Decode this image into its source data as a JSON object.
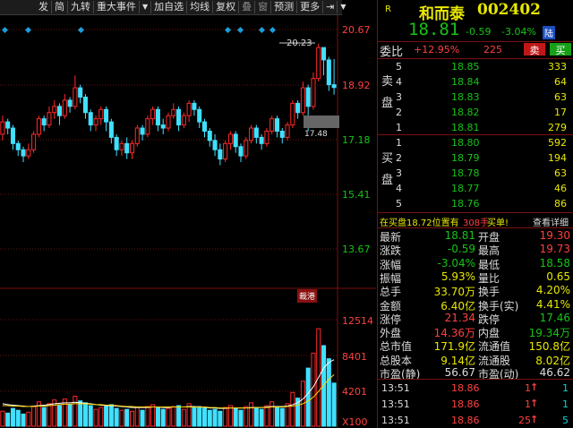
{
  "toolbar": {
    "items": [
      "发",
      "简",
      "九转",
      "重大事件",
      "加自选",
      "均线",
      "复权",
      "叠",
      "窗",
      "预测",
      "更多"
    ],
    "arrow_label": "⇥",
    "dropdown_label": "▼"
  },
  "chart": {
    "price_ticks": [
      "20.67",
      "18.92",
      "17.18",
      "15.41",
      "13.67"
    ],
    "volume_ticks": [
      "12514",
      "8401",
      "4201"
    ],
    "volume_unit": "X100",
    "high_label": "20.23",
    "low_label": "17.48",
    "tag_label": "裁港",
    "price_range": [
      12.7,
      21.0
    ],
    "volume_max": 12514,
    "up_color": "#ff2a2a",
    "down_color": "#40e0ff",
    "candles": [
      [
        17.3,
        17.7,
        17.9,
        17.1
      ],
      [
        17.7,
        17.5,
        17.8,
        17.3
      ],
      [
        17.5,
        17.0,
        17.6,
        16.8
      ],
      [
        17.0,
        16.8,
        17.1,
        16.6
      ],
      [
        16.8,
        16.6,
        16.9,
        16.4
      ],
      [
        16.6,
        16.8,
        17.0,
        16.5
      ],
      [
        16.8,
        17.3,
        17.4,
        16.7
      ],
      [
        17.3,
        17.8,
        17.9,
        17.2
      ],
      [
        17.8,
        17.6,
        17.9,
        17.4
      ],
      [
        17.6,
        18.0,
        18.2,
        17.5
      ],
      [
        18.0,
        18.2,
        18.4,
        17.8
      ],
      [
        18.2,
        17.9,
        18.3,
        17.6
      ],
      [
        17.9,
        18.4,
        18.6,
        17.8
      ],
      [
        18.4,
        18.2,
        18.5,
        18.0
      ],
      [
        18.2,
        18.8,
        19.2,
        18.1
      ],
      [
        18.8,
        18.5,
        18.9,
        18.3
      ],
      [
        18.5,
        18.0,
        18.6,
        17.8
      ],
      [
        18.0,
        17.6,
        18.1,
        17.4
      ],
      [
        17.6,
        17.8,
        17.9,
        17.4
      ],
      [
        17.8,
        18.1,
        18.2,
        17.6
      ],
      [
        18.1,
        17.7,
        18.2,
        17.4
      ],
      [
        17.7,
        17.2,
        17.8,
        17.0
      ],
      [
        17.2,
        16.8,
        17.3,
        16.6
      ],
      [
        16.8,
        17.0,
        17.1,
        16.6
      ],
      [
        17.0,
        16.7,
        17.2,
        16.5
      ],
      [
        16.7,
        17.0,
        17.1,
        16.5
      ],
      [
        17.0,
        17.5,
        17.6,
        16.9
      ],
      [
        17.5,
        17.3,
        17.6,
        17.1
      ],
      [
        17.3,
        17.8,
        17.9,
        17.2
      ],
      [
        17.8,
        18.1,
        18.2,
        17.6
      ],
      [
        18.1,
        17.6,
        18.2,
        17.4
      ],
      [
        17.6,
        17.5,
        17.8,
        17.3
      ],
      [
        17.5,
        17.9,
        18.0,
        17.4
      ],
      [
        17.9,
        18.1,
        18.3,
        17.8
      ],
      [
        18.1,
        17.6,
        18.2,
        17.4
      ],
      [
        17.6,
        17.9,
        18.0,
        17.5
      ],
      [
        17.9,
        18.3,
        18.4,
        17.7
      ],
      [
        18.3,
        18.1,
        18.4,
        17.9
      ],
      [
        18.1,
        17.7,
        18.2,
        17.5
      ],
      [
        17.7,
        17.4,
        17.8,
        17.2
      ],
      [
        17.4,
        17.1,
        17.5,
        16.9
      ],
      [
        17.1,
        16.8,
        17.3,
        16.6
      ],
      [
        16.8,
        16.5,
        17.0,
        16.3
      ],
      [
        16.5,
        17.0,
        17.1,
        16.4
      ],
      [
        17.0,
        17.3,
        17.4,
        16.8
      ],
      [
        17.3,
        16.9,
        17.4,
        16.7
      ],
      [
        16.9,
        16.6,
        17.0,
        16.4
      ],
      [
        16.6,
        17.1,
        17.2,
        16.5
      ],
      [
        17.1,
        17.5,
        17.6,
        17.0
      ],
      [
        17.5,
        17.2,
        17.6,
        17.0
      ],
      [
        17.2,
        17.0,
        17.3,
        16.8
      ],
      [
        17.0,
        17.4,
        17.5,
        16.9
      ],
      [
        17.4,
        17.8,
        17.9,
        17.3
      ],
      [
        17.8,
        17.4,
        17.9,
        17.2
      ],
      [
        17.4,
        17.2,
        17.5,
        17.0
      ],
      [
        17.2,
        17.6,
        17.7,
        17.1
      ],
      [
        17.6,
        18.3,
        18.4,
        17.5
      ],
      [
        18.3,
        18.0,
        18.4,
        17.8
      ],
      [
        18.0,
        18.8,
        19.0,
        17.9
      ],
      [
        18.8,
        18.2,
        18.9,
        17.4
      ],
      [
        18.2,
        19.1,
        19.3,
        18.1
      ],
      [
        19.1,
        20.1,
        20.23,
        19.0
      ],
      [
        20.1,
        19.7,
        20.1,
        19.2
      ],
      [
        19.7,
        18.9,
        19.8,
        18.7
      ],
      [
        18.9,
        18.81,
        19.73,
        18.58
      ]
    ],
    "volumes": [
      [
        1600,
        0
      ],
      [
        1400,
        1
      ],
      [
        1900,
        1
      ],
      [
        1700,
        1
      ],
      [
        1300,
        1
      ],
      [
        1500,
        0
      ],
      [
        2100,
        0
      ],
      [
        2600,
        0
      ],
      [
        2000,
        1
      ],
      [
        2400,
        0
      ],
      [
        2800,
        0
      ],
      [
        2200,
        1
      ],
      [
        2900,
        0
      ],
      [
        2300,
        1
      ],
      [
        3200,
        0
      ],
      [
        2700,
        1
      ],
      [
        2500,
        1
      ],
      [
        2200,
        1
      ],
      [
        1800,
        0
      ],
      [
        2000,
        0
      ],
      [
        2100,
        1
      ],
      [
        2300,
        1
      ],
      [
        1900,
        1
      ],
      [
        1700,
        0
      ],
      [
        1800,
        1
      ],
      [
        1600,
        0
      ],
      [
        2000,
        0
      ],
      [
        1700,
        1
      ],
      [
        2100,
        0
      ],
      [
        2300,
        0
      ],
      [
        2000,
        1
      ],
      [
        1800,
        1
      ],
      [
        1900,
        0
      ],
      [
        2100,
        0
      ],
      [
        2200,
        1
      ],
      [
        1800,
        0
      ],
      [
        2400,
        0
      ],
      [
        2000,
        1
      ],
      [
        2100,
        1
      ],
      [
        1900,
        1
      ],
      [
        1700,
        1
      ],
      [
        1800,
        1
      ],
      [
        1600,
        1
      ],
      [
        2000,
        0
      ],
      [
        2200,
        0
      ],
      [
        1900,
        1
      ],
      [
        1700,
        1
      ],
      [
        2100,
        0
      ],
      [
        2500,
        0
      ],
      [
        2000,
        1
      ],
      [
        1800,
        1
      ],
      [
        2200,
        0
      ],
      [
        2600,
        0
      ],
      [
        2100,
        1
      ],
      [
        1900,
        1
      ],
      [
        2400,
        0
      ],
      [
        3600,
        0
      ],
      [
        3000,
        1
      ],
      [
        4800,
        0
      ],
      [
        6200,
        1
      ],
      [
        7800,
        0
      ],
      [
        10400,
        0
      ],
      [
        8600,
        1
      ],
      [
        7200,
        1
      ],
      [
        4600,
        1
      ]
    ],
    "ma_vol_1": [
      2400,
      2300,
      2250,
      2200,
      2150,
      2100,
      2150,
      2200,
      2250,
      2300,
      2400,
      2450,
      2500,
      2500,
      2550,
      2500,
      2450,
      2400,
      2300,
      2250,
      2200,
      2200,
      2150,
      2100,
      2050,
      2000,
      2000,
      2000,
      2000,
      2050,
      2050,
      2000,
      2000,
      2050,
      2050,
      2050,
      2100,
      2100,
      2050,
      2000,
      1950,
      1950,
      1900,
      1900,
      1950,
      1950,
      1950,
      1950,
      2000,
      2000,
      2000,
      2050,
      2100,
      2100,
      2100,
      2150,
      2300,
      2500,
      2900,
      3500,
      4200,
      5200,
      6200,
      6800,
      7100
    ],
    "ma_vol_2": [
      2200,
      2200,
      2150,
      2150,
      2100,
      2100,
      2100,
      2150,
      2150,
      2200,
      2250,
      2300,
      2350,
      2350,
      2400,
      2400,
      2400,
      2350,
      2300,
      2300,
      2250,
      2250,
      2200,
      2150,
      2100,
      2100,
      2050,
      2050,
      2050,
      2050,
      2050,
      2050,
      2050,
      2050,
      2050,
      2050,
      2050,
      2050,
      2050,
      2050,
      2000,
      2000,
      1950,
      1950,
      1950,
      1950,
      1950,
      1950,
      1950,
      2000,
      2000,
      2000,
      2050,
      2050,
      2050,
      2100,
      2150,
      2250,
      2400,
      2700,
      3100,
      3700,
      4400,
      5000,
      5500
    ]
  },
  "quote": {
    "flag": "R",
    "name": "和而泰",
    "code": "002402",
    "price": "18.81",
    "change": "-0.59",
    "change_pct": "-3.04%",
    "market_tag": "陆",
    "commission_label": "委比",
    "commission_ratio": "+12.95%",
    "commission_diff": "225",
    "sell_button": "卖",
    "buy_button": "买",
    "sell_side_label": "卖盘",
    "buy_side_label": "买盘",
    "asks": [
      {
        "level": "5",
        "price": "18.85",
        "vol": "333"
      },
      {
        "level": "4",
        "price": "18.84",
        "vol": "64"
      },
      {
        "level": "3",
        "price": "18.83",
        "vol": "63"
      },
      {
        "level": "2",
        "price": "18.82",
        "vol": "17"
      },
      {
        "level": "1",
        "price": "18.81",
        "vol": "279"
      }
    ],
    "bids": [
      {
        "level": "1",
        "price": "18.80",
        "vol": "592"
      },
      {
        "level": "2",
        "price": "18.79",
        "vol": "194"
      },
      {
        "level": "3",
        "price": "18.78",
        "vol": "63"
      },
      {
        "level": "4",
        "price": "18.77",
        "vol": "46"
      },
      {
        "level": "5",
        "price": "18.76",
        "vol": "86"
      }
    ],
    "notice_prefix": "在买盘18.72位置有",
    "notice_vol": "308手",
    "notice_action": "买单!",
    "notice_link": "查看详细",
    "stats": [
      {
        "l": "最新",
        "lv": "18.81",
        "lc": "g",
        "r": "开盘",
        "rv": "19.30",
        "rc": "r"
      },
      {
        "l": "涨跌",
        "lv": "-0.59",
        "lc": "g",
        "r": "最高",
        "rv": "19.73",
        "rc": "r"
      },
      {
        "l": "涨幅",
        "lv": "-3.04%",
        "lc": "g",
        "r": "最低",
        "rv": "18.58",
        "rc": "g"
      },
      {
        "l": "振幅",
        "lv": "5.93%",
        "lc": "y",
        "r": "量比",
        "rv": "0.65",
        "rc": "y"
      },
      {
        "l": "总手",
        "lv": "33.70万",
        "lc": "y",
        "r": "换手",
        "rv": "4.20%",
        "rc": "y"
      },
      {
        "l": "金额",
        "lv": "6.40亿",
        "lc": "y",
        "r": "换手(实)",
        "rv": "4.41%",
        "rc": "y"
      },
      {
        "l": "涨停",
        "lv": "21.34",
        "lc": "r",
        "r": "跌停",
        "rv": "17.46",
        "rc": "g"
      },
      {
        "l": "外盘",
        "lv": "14.36万",
        "lc": "r",
        "r": "内盘",
        "rv": "19.34万",
        "rc": "g"
      },
      {
        "l": "总市值",
        "lv": "171.9亿",
        "lc": "y",
        "r": "流通值",
        "rv": "150.8亿",
        "rc": "y"
      },
      {
        "l": "总股本",
        "lv": "9.14亿",
        "lc": "y",
        "r": "流通股",
        "rv": "8.02亿",
        "rc": "y"
      },
      {
        "l": "市盈(静)",
        "lv": "56.67",
        "lc": "w",
        "r": "市盈(动)",
        "rv": "46.62",
        "rc": "w"
      }
    ],
    "ticks": [
      {
        "time": "13:51",
        "price": "18.86",
        "vol": "1",
        "num": "1"
      },
      {
        "time": "13:51",
        "price": "18.86",
        "vol": "1",
        "num": "1"
      },
      {
        "time": "13:51",
        "price": "18.86",
        "vol": "25",
        "num": "5"
      }
    ],
    "up_arrow": "↑"
  }
}
